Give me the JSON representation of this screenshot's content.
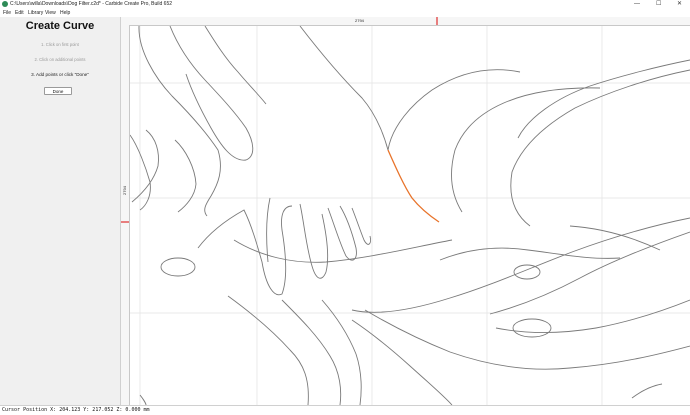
{
  "window": {
    "title": "C:\\Users\\willa\\Downloads\\Dog Filter.c2d* - Carbide Create Pro, Build 652",
    "minimize": "—",
    "maximize": "☐",
    "close": "✕"
  },
  "menu": {
    "items": [
      "File",
      "Edit",
      "Library",
      "View",
      "Help"
    ]
  },
  "panel": {
    "title": "Create Curve",
    "steps": [
      "1. Click on first point",
      "2. Click on additional points",
      "3. Add points or click \"Done\""
    ],
    "done_label": "Done"
  },
  "rulers": {
    "top_label": "2794",
    "left_label": "2794"
  },
  "status": {
    "cursor_position": "Cursor Position X: 204.123 Y: 217.052 Z: 0.000 mm"
  },
  "colors": {
    "active_curve": "#e8732a",
    "ruler_marker": "#e03030",
    "grid": "#e2e2e2",
    "geometry": "#7a7a7a"
  }
}
